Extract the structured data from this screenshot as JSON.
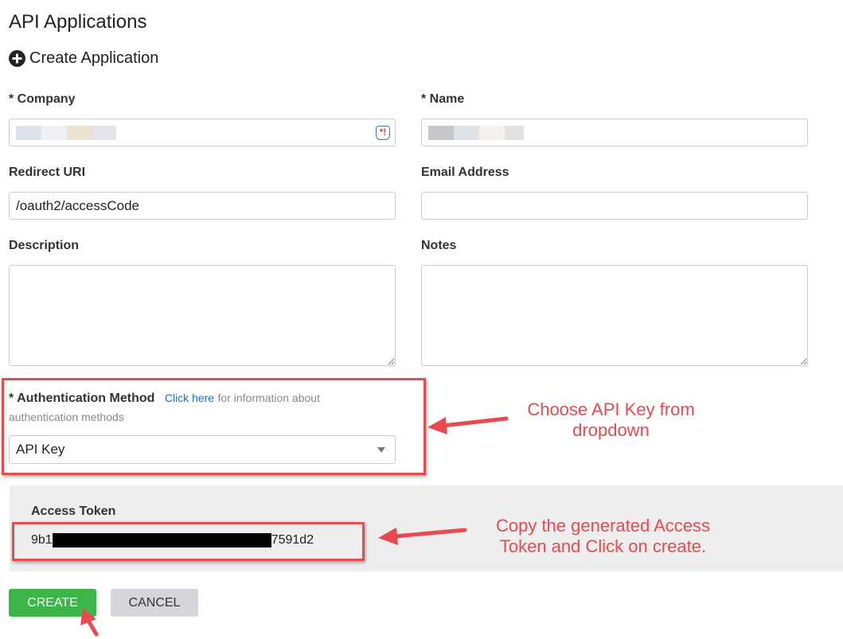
{
  "page": {
    "title": "API Applications"
  },
  "section": {
    "title": "Create Application"
  },
  "form": {
    "company": {
      "label": "* Company"
    },
    "name": {
      "label": "* Name"
    },
    "redirect_uri": {
      "label": "Redirect URI",
      "value": "/oauth2/accessCode"
    },
    "email": {
      "label": "Email Address",
      "value": ""
    },
    "description": {
      "label": "Description",
      "value": ""
    },
    "notes": {
      "label": "Notes",
      "value": ""
    },
    "auth_method": {
      "label": "* Authentication Method",
      "link": "Click here",
      "help_suffix": "for information about",
      "help_line2": "authentication methods",
      "selected": "API Key"
    },
    "access_token": {
      "label": "Access Token",
      "value_prefix": "9b1",
      "value_suffix": "7591d2"
    }
  },
  "buttons": {
    "create": "CREATE",
    "cancel": "CANCEL"
  },
  "annotations": {
    "auth_note": [
      "Choose API Key from",
      "dropdown"
    ],
    "token_note": [
      "Copy the generated Access",
      "Token and Click on create."
    ]
  },
  "colors": {
    "create_button": "#3cb54a",
    "annotation_red": "#e84a50",
    "link_blue": "#1a6fc4",
    "token_panel_bg": "#eeeeee"
  }
}
